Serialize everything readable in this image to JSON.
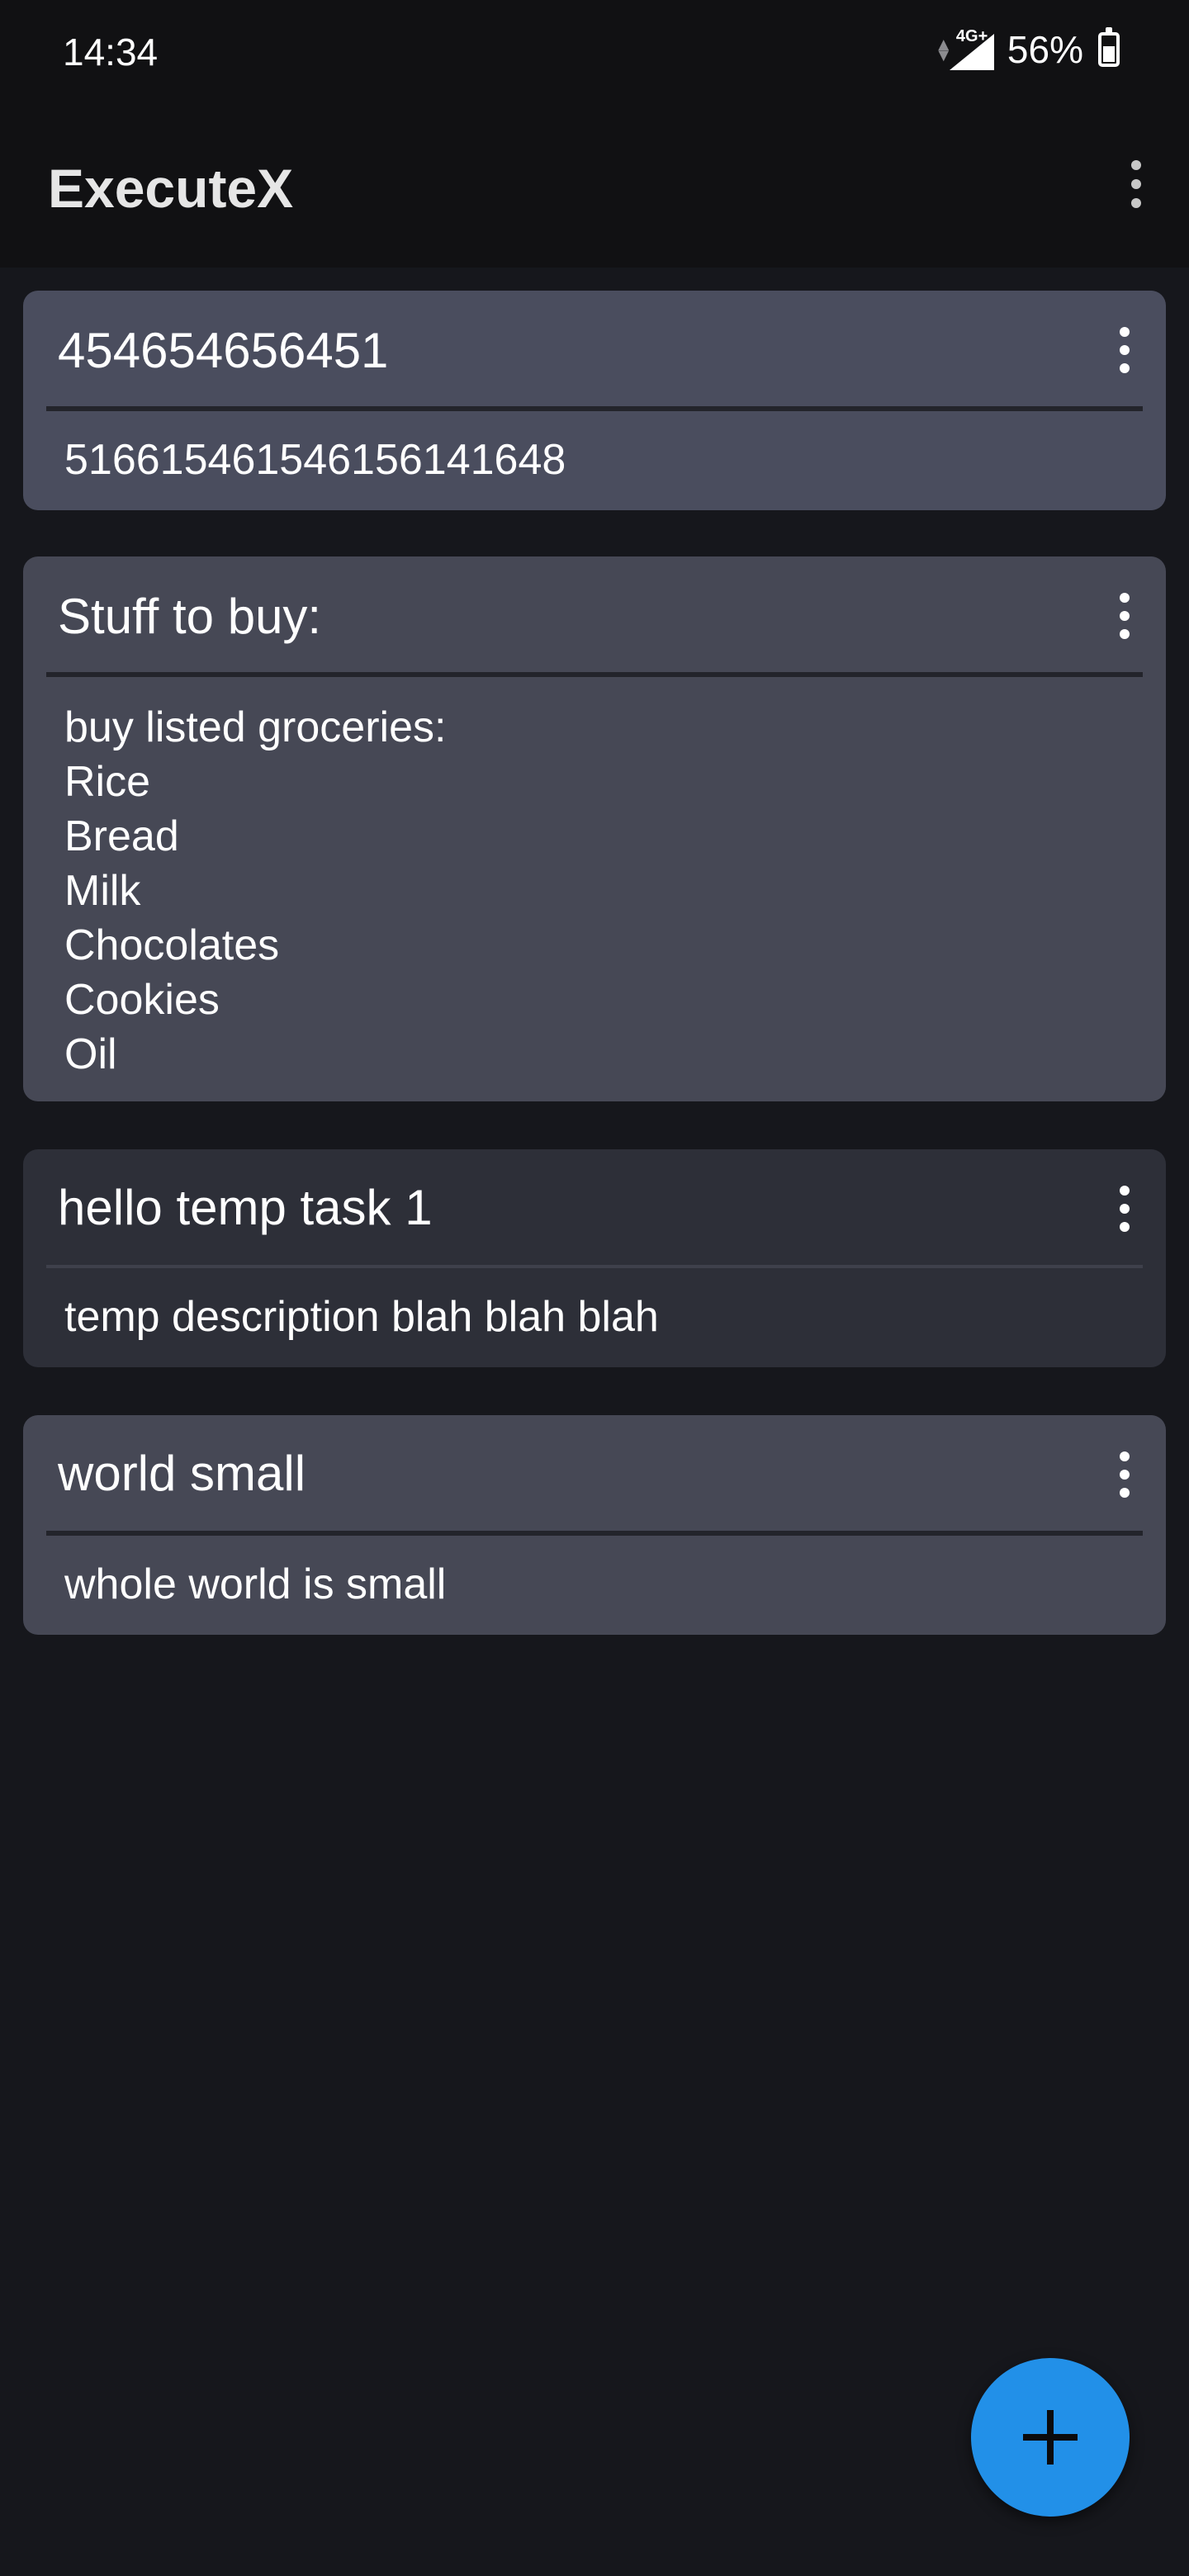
{
  "status_bar": {
    "time": "14:34",
    "network": "4G+",
    "battery": "56%",
    "battery_level": 0.56
  },
  "app_bar": {
    "title": "ExecuteX"
  },
  "tasks": [
    {
      "title": "454654656451",
      "description": "516615461546156141648",
      "color": "#4a4d5e"
    },
    {
      "title": "Stuff to buy:",
      "description": "buy listed groceries:\nRice\nBread\nMilk\nChocolates\nCookies\nOil",
      "color": "#464855"
    },
    {
      "title": "hello temp task 1",
      "description": "temp description blah blah blah",
      "color": "#2d2f38"
    },
    {
      "title": "world small",
      "description": "whole world is small",
      "color": "#464855"
    }
  ],
  "fab": {
    "icon": "plus-icon",
    "color": "#2290e8"
  }
}
